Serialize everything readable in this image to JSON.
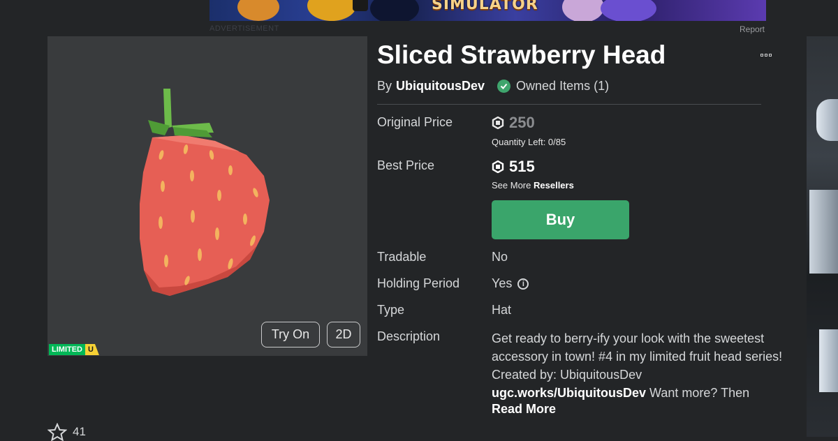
{
  "ad": {
    "banner_title": "SIMULATOR",
    "label": "ADVERTISEMENT",
    "report": "Report"
  },
  "item": {
    "title": "Sliced Strawberry Head",
    "by_prefix": "By",
    "creator": "UbiquitousDev",
    "owned_items": "Owned Items (1)"
  },
  "thumbnail": {
    "try_on": "Try On",
    "view_2d": "2D",
    "badge_limited": "LIMITED",
    "badge_unique": "U"
  },
  "details": {
    "original_price_label": "Original Price",
    "original_price": "250",
    "quantity_left": "Quantity Left: 0/85",
    "best_price_label": "Best Price",
    "best_price": "515",
    "see_more_prefix": "See More",
    "see_more_link": "Resellers",
    "buy": "Buy",
    "tradable_label": "Tradable",
    "tradable_value": "No",
    "holding_label": "Holding Period",
    "holding_value": "Yes",
    "type_label": "Type",
    "type_value": "Hat",
    "description_label": "Description",
    "description_text": "Get ready to berry-ify your look with the sweetest accessory in town! #4 in my limited fruit head series! Created by: UbiquitousDev",
    "description_link": "ugc.works/UbiquitousDev",
    "description_tail": "Want more? Then",
    "read_more": "Read More"
  },
  "favorites": {
    "count": "41"
  },
  "colors": {
    "background": "#232527",
    "buy_green": "#3aa56b",
    "limited_green": "#02b757",
    "unique_yellow": "#f6d135"
  },
  "icons": {
    "robux": "robux-icon",
    "owned": "check-circle-icon",
    "more": "more-options-icon",
    "info": "info-icon",
    "favorite": "star-icon"
  }
}
